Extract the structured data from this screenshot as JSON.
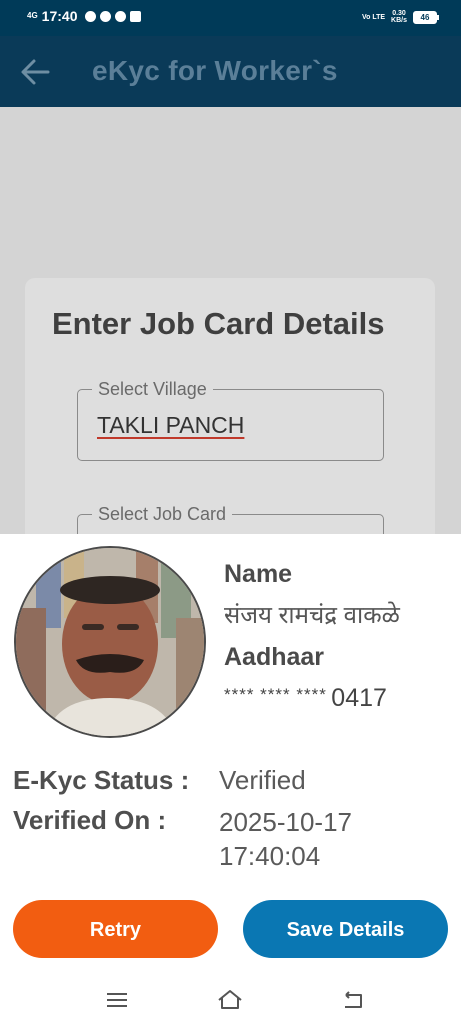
{
  "status_bar": {
    "network_tag": "4G",
    "time": "17:40",
    "net_speed_top": "0.30",
    "net_speed_bottom": "KB/s",
    "network_type": "Vo LTE",
    "battery": "46"
  },
  "app_bar": {
    "title": "eKyc for Worker`s"
  },
  "form": {
    "title": "Enter Job Card Details",
    "village_label": "Select Village",
    "village_value": "TAKLI PANCH",
    "job_card_label": "Select Job Card"
  },
  "details": {
    "name_label": "Name",
    "name_value": "संजय रामचंद्र वाकळे",
    "aadhaar_label": "Aadhaar",
    "aadhaar_masked": "**** **** ****",
    "aadhaar_last4": "0417",
    "status_label": "E-Kyc Status :",
    "status_value": "Verified",
    "verified_on_label": "Verified On :",
    "verified_on_date": "2025-10-17",
    "verified_on_time": "17:40:04"
  },
  "buttons": {
    "retry": "Retry",
    "save": "Save Details"
  },
  "colors": {
    "app_bar": "#0a3a58",
    "retry": "#f25d11",
    "save": "#0a77b3"
  }
}
